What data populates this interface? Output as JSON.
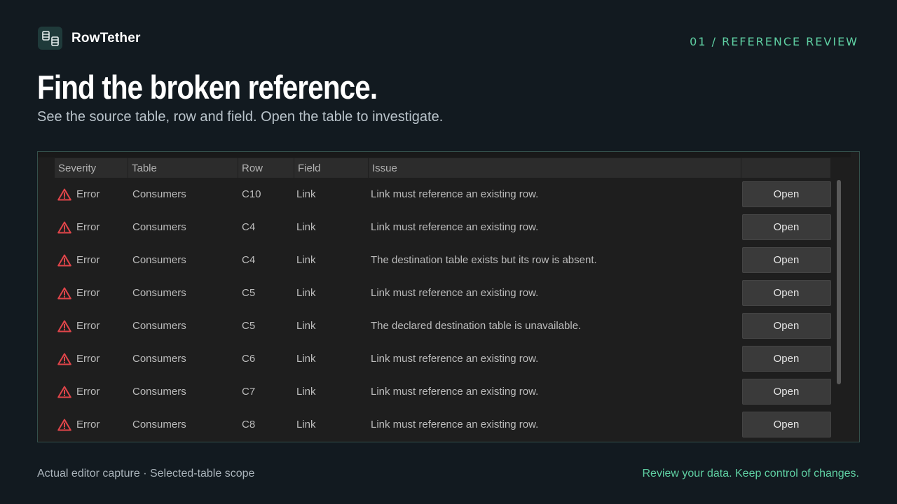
{
  "brand": {
    "name": "RowTether",
    "logo_icon": "table-link-icon"
  },
  "eyebrow": "01 / REFERENCE REVIEW",
  "headline": "Find the broken reference.",
  "subhead": "See the source table, row and field. Open the table to investigate.",
  "colors": {
    "accent": "#5fd0a3",
    "background": "#121a20",
    "error": "#e0454a"
  },
  "table": {
    "columns": [
      "Severity",
      "Table",
      "Row",
      "Field",
      "Issue",
      ""
    ],
    "rows": [
      {
        "severity": "Error",
        "table": "Consumers",
        "row": "C10",
        "field": "Link",
        "issue": "Link must reference an existing row.",
        "action": "Open"
      },
      {
        "severity": "Error",
        "table": "Consumers",
        "row": "C4",
        "field": "Link",
        "issue": "Link must reference an existing row.",
        "action": "Open"
      },
      {
        "severity": "Error",
        "table": "Consumers",
        "row": "C4",
        "field": "Link",
        "issue": "The destination table exists but its row is absent.",
        "action": "Open"
      },
      {
        "severity": "Error",
        "table": "Consumers",
        "row": "C5",
        "field": "Link",
        "issue": "Link must reference an existing row.",
        "action": "Open"
      },
      {
        "severity": "Error",
        "table": "Consumers",
        "row": "C5",
        "field": "Link",
        "issue": "The declared destination table is unavailable.",
        "action": "Open"
      },
      {
        "severity": "Error",
        "table": "Consumers",
        "row": "C6",
        "field": "Link",
        "issue": "Link must reference an existing row.",
        "action": "Open"
      },
      {
        "severity": "Error",
        "table": "Consumers",
        "row": "C7",
        "field": "Link",
        "issue": "Link must reference an existing row.",
        "action": "Open"
      },
      {
        "severity": "Error",
        "table": "Consumers",
        "row": "C8",
        "field": "Link",
        "issue": "Link must reference an existing row.",
        "action": "Open"
      }
    ]
  },
  "footer": {
    "left": "Actual editor capture · Selected-table scope",
    "right": "Review your data. Keep control of changes."
  }
}
